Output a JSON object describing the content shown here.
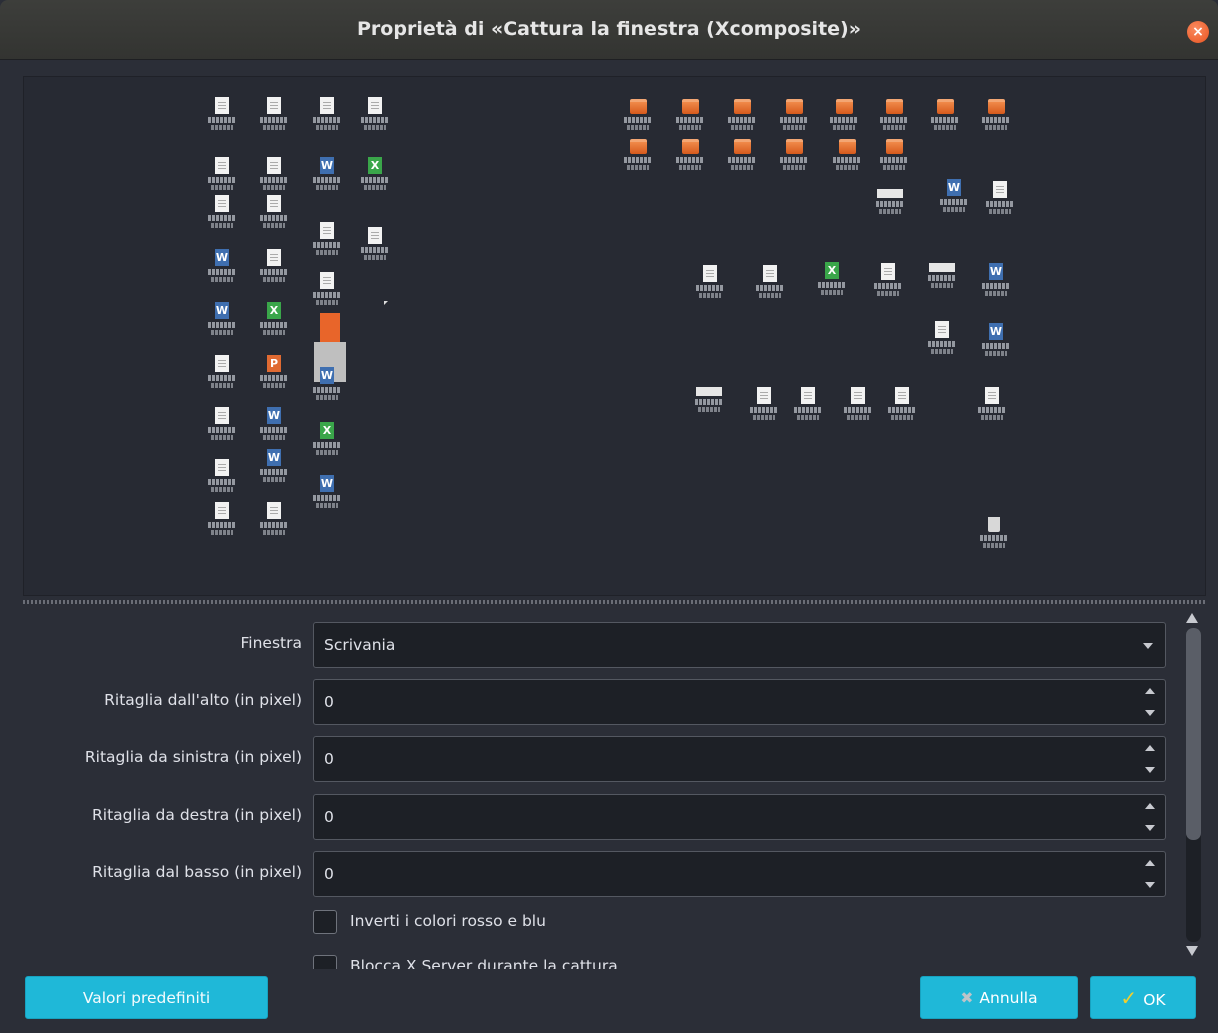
{
  "window": {
    "title": "Proprietà di «Cattura la finestra (Xcomposite)»"
  },
  "preview": {
    "left_icons": [
      "doc",
      "doc",
      "doc",
      "doc",
      "doc",
      "doc",
      "word",
      "calc",
      "doc",
      "doc",
      "doc",
      "doc",
      "word",
      "doc",
      "doc",
      "word",
      "calc",
      "word",
      "doc",
      "pres",
      "doc",
      "word",
      "calc",
      "doc",
      "word",
      "word",
      "doc",
      "doc"
    ],
    "right_folders": 14,
    "right_icons": [
      "white",
      "word",
      "doc",
      "doc",
      "doc",
      "calc",
      "doc",
      "white",
      "word",
      "doc",
      "word",
      "white",
      "doc",
      "doc",
      "doc",
      "doc",
      "doc",
      "trash"
    ]
  },
  "form": {
    "window_label": "Finestra",
    "window_value": "Scrivania",
    "crop_top_label": "Ritaglia dall'alto (in pixel)",
    "crop_top_value": "0",
    "crop_left_label": "Ritaglia da sinistra (in pixel)",
    "crop_left_value": "0",
    "crop_right_label": "Ritaglia da destra (in pixel)",
    "crop_right_value": "0",
    "crop_bottom_label": "Ritaglia dal basso (in pixel)",
    "crop_bottom_value": "0",
    "swap_colors_label": "Inverti i colori rosso e blu",
    "lock_x_label": "Blocca X Server durante la cattura"
  },
  "buttons": {
    "defaults": "Valori predefiniti",
    "cancel": "Annulla",
    "ok": "OK"
  },
  "colors": {
    "accent": "#1fb8d8",
    "close": "#e95420",
    "background": "#2b2e37"
  }
}
